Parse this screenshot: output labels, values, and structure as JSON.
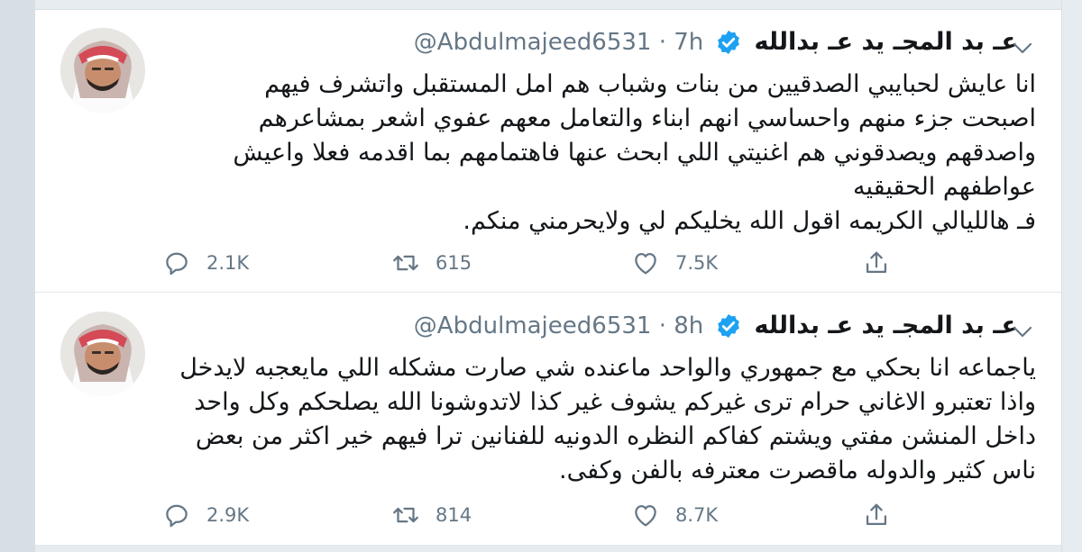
{
  "tweets": [
    {
      "author_name": "عـ بد المجـ يد عـ بدالله",
      "handle": "@Abdulmajeed6531",
      "time": "· 7h",
      "body_lines": [
        "انا عايش لحبايبي الصدقيين من بنات وشباب هم امل المستقبل واتشرف فيهم",
        "اصبحت جزء منهم واحساسي انهم ابناء والتعامل معهم عفوي اشعر بمشاعرهم",
        "واصدقهم ويصدقوني هم اغنيتي اللي ابحث عنها فاهتمامهم بما اقدمه فعلا واعيش",
        "عواطفهم الحقيقيه",
        "فـ هالليالي الكريمه اقول الله يخليكم لي ولايحرمني منكم."
      ],
      "replies": "2.1K",
      "retweets": "615",
      "likes": "7.5K"
    },
    {
      "author_name": "عـ بد المجـ يد عـ بدالله",
      "handle": "@Abdulmajeed6531",
      "time": "· 8h",
      "body_lines": [
        "ياجماعه انا بحكي مع جمهوري والواحد ماعنده شي صارت مشكله اللي مايعجبه لايدخل",
        "واذا تعتبرو الاغاني حرام ترى غيركم يشوف غير كذا لاتدوشونا الله يصلحكم وكل واحد",
        "داخل المنشن مفتي ويشتم كفاكم النظره الدونيه للفنانين ترا فيهم خير اكثر من بعض",
        "ناس كثير والدوله ماقصرت معترفه بالفن وكفى."
      ],
      "replies": "2.9K",
      "retweets": "814",
      "likes": "8.7K"
    }
  ],
  "colors": {
    "accent": "#1da1f2",
    "muted": "#657786",
    "text": "#14171a"
  },
  "icons": [
    "reply-icon",
    "retweet-icon",
    "like-icon",
    "share-icon",
    "verified-icon",
    "chevron-down-icon"
  ]
}
